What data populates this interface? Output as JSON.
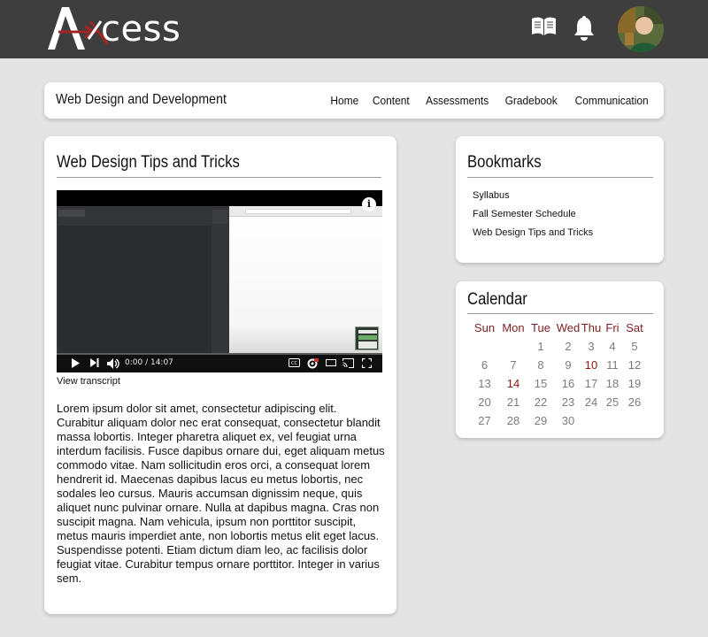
{
  "app": {
    "logo_text": "cess",
    "logo_letter": "A"
  },
  "header": {
    "icons": [
      "book-icon",
      "bell-icon"
    ],
    "avatar": "user-avatar"
  },
  "course": {
    "title": "Web Design and Development",
    "nav": [
      "Home",
      "Content",
      "Assessments",
      "Gradebook",
      "Communication"
    ]
  },
  "main": {
    "title": "Web Design Tips and Tricks",
    "video": {
      "time": "0:00 / 14:07",
      "progress": 0
    },
    "transcript_link": "View transcript",
    "body": "Lorem ipsum dolor sit amet, consectetur adipiscing elit. Curabitur aliquam dolor nec erat consequat, consectetur blandit massa lobortis. Integer pharetra aliquet ex, vel feugiat urna interdum facilisis. Fusce dapibus ornare dui, eget aliquam metus commodo vitae. Nam sollicitudin eros orci, a consequat lorem hendrerit id. Maecenas dapibus lacus eu metus lobortis, nec sodales leo cursus. Mauris accumsan dignissim neque, quis aliquet nunc pulvinar ornare. Nulla at dapibus magna. Cras non suscipit magna. Nam vehicula, ipsum non porttitor suscipit, metus mauris imperdiet ante, non lobortis metus elit eget lacus. Suspendisse potenti. Etiam dictum diam leo, ac facilisis dolor feugiat vitae. Curabitur tempus ornare porttitor. Integer in varius sem."
  },
  "bookmarks": {
    "title": "Bookmarks",
    "items": [
      "Syllabus",
      "Fall Semester Schedule",
      "Web Design Tips and Tricks"
    ]
  },
  "calendar": {
    "title": "Calendar",
    "days": [
      "Sun",
      "Mon",
      "Tue",
      "Wed",
      "Thu",
      "Fri",
      "Sat"
    ],
    "weeks": [
      [
        "",
        "",
        "1",
        "2",
        "3",
        "4",
        "5"
      ],
      [
        "6",
        "7",
        "8",
        "9",
        "10",
        "11",
        "12"
      ],
      [
        "13",
        "14",
        "15",
        "16",
        "17",
        "18",
        "19"
      ],
      [
        "20",
        "21",
        "22",
        "23",
        "24",
        "25",
        "26"
      ],
      [
        "27",
        "28",
        "29",
        "30",
        "",
        "",
        ""
      ]
    ],
    "highlighted": [
      "10",
      "14"
    ],
    "highlight_color": "#8b1717",
    "day_header_color": "#7e1e1e"
  },
  "colors": {
    "header_bg": "#3e3e3e",
    "page_bg": "#e4e4e4",
    "accent": "#a32424"
  }
}
